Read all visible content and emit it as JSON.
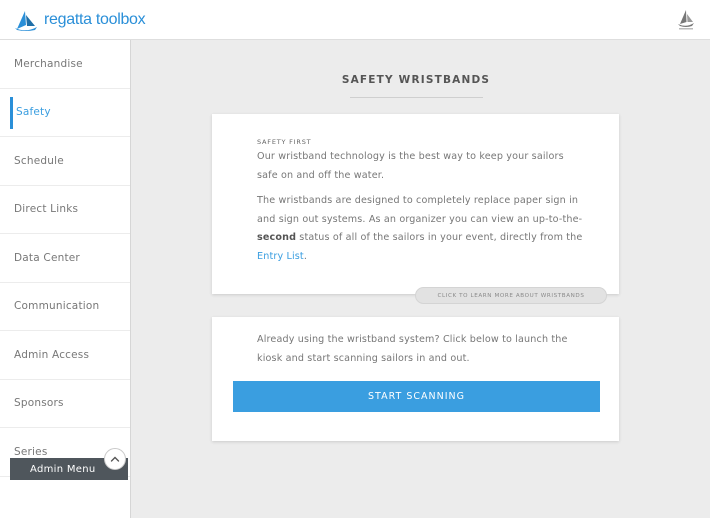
{
  "app": {
    "logo_text": "regatta toolbox"
  },
  "sidebar": {
    "items": [
      {
        "label": "Merchandise",
        "active": false
      },
      {
        "label": "Safety",
        "active": true
      },
      {
        "label": "Schedule",
        "active": false
      },
      {
        "label": "Direct Links",
        "active": false
      },
      {
        "label": "Data Center",
        "active": false
      },
      {
        "label": "Communication",
        "active": false
      },
      {
        "label": "Admin Access",
        "active": false
      },
      {
        "label": "Sponsors",
        "active": false
      },
      {
        "label": "Series",
        "active": false
      }
    ],
    "admin_menu_label": "Admin Menu"
  },
  "main": {
    "title": "SAFETY WRISTBANDS",
    "info_card": {
      "overline": "SAFETY FIRST",
      "para1": "Our wristband technology is the best way to keep your sailors safe on and off the water.",
      "para2_before_bold": "The wristbands are designed to completely replace paper sign in and sign out systems. As an organizer you can view an up-to-the-",
      "para2_bold": "second",
      "para2_after_bold": " status of all of the sailors in your event, directly from the ",
      "para2_link": "Entry List",
      "para2_end": ".",
      "learn_more": "CLICK TO LEARN MORE ABOUT WRISTBANDS"
    },
    "scan_card": {
      "text": "Already using the wristband system? Click below to launch the kiosk and start scanning sailors in and out.",
      "button": "START SCANNING"
    }
  },
  "colors": {
    "accent": "#3a9ee0",
    "admin_menu_bg": "#4f565c",
    "page_bg": "#ececec"
  }
}
